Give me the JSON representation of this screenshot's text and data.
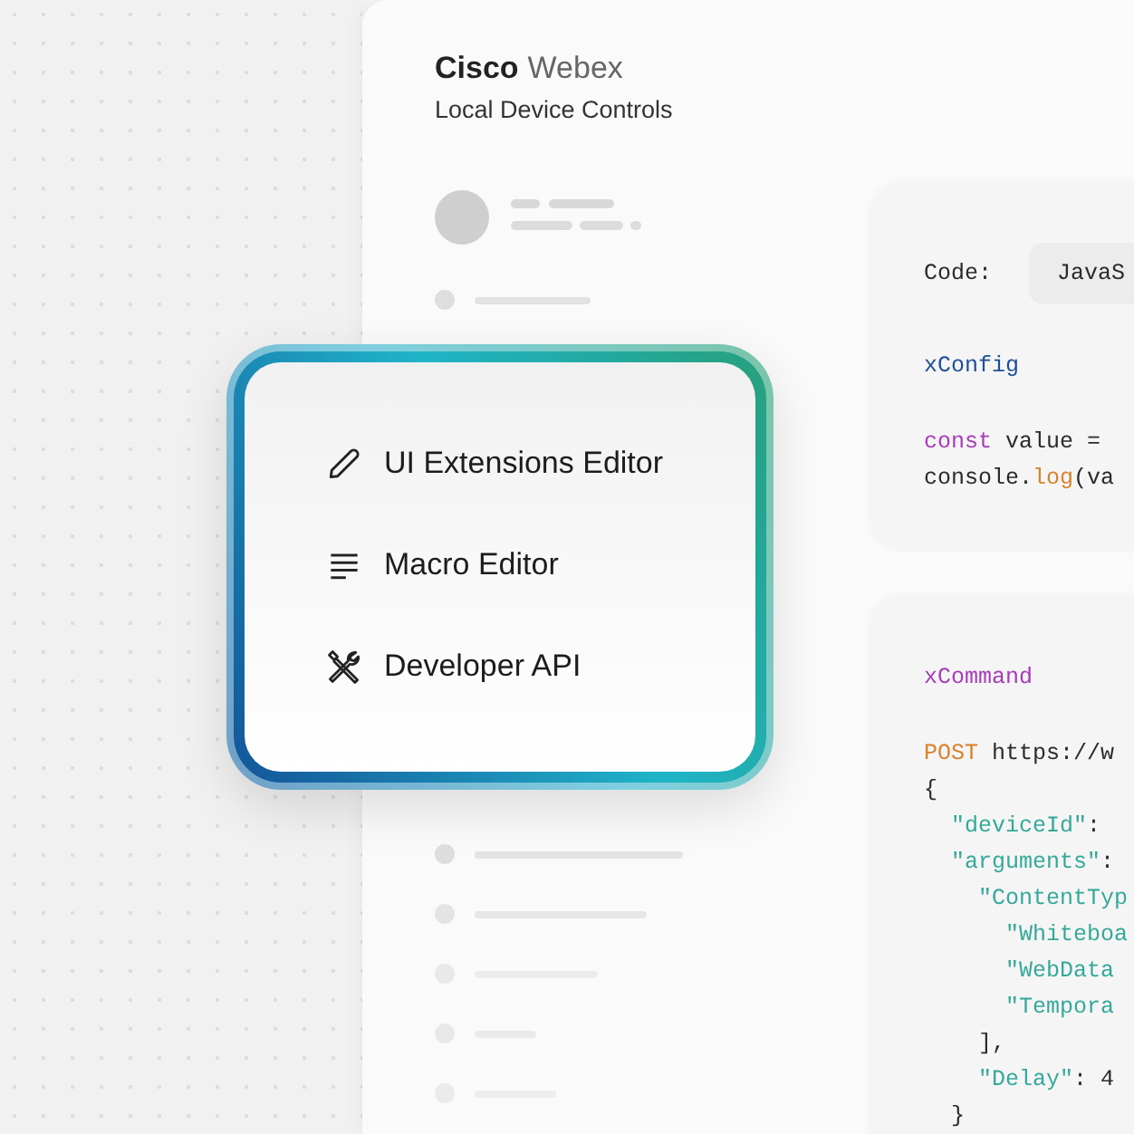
{
  "header": {
    "brand": "Cisco",
    "product": "Webex",
    "subtitle": "Local Device Controls"
  },
  "menu": {
    "items": [
      {
        "label": "UI Extensions Editor"
      },
      {
        "label": "Macro Editor"
      },
      {
        "label": "Developer API"
      }
    ]
  },
  "code_panels": [
    {
      "language_label": "Code:",
      "language": "JavaS",
      "blocks": [
        [
          [
            {
              "text": "xConfig",
              "kind": "type"
            }
          ]
        ],
        [
          [
            {
              "text": "const",
              "kind": "keyword"
            },
            {
              "text": " value =",
              "kind": "plain"
            }
          ],
          [
            {
              "text": "console.",
              "kind": "plain"
            },
            {
              "text": "log",
              "kind": "func"
            },
            {
              "text": "(va",
              "kind": "plain"
            }
          ]
        ]
      ]
    },
    {
      "blocks": [
        [
          [
            {
              "text": "xCommand",
              "kind": "keyword"
            }
          ]
        ],
        [
          [
            {
              "text": "POST",
              "kind": "func"
            },
            {
              "text": " https://w",
              "kind": "plain"
            }
          ],
          [
            {
              "text": "{",
              "kind": "plain"
            }
          ],
          [
            {
              "text": "  \"deviceId\"",
              "kind": "string"
            },
            {
              "text": ":",
              "kind": "plain"
            }
          ],
          [
            {
              "text": "  \"arguments\"",
              "kind": "string"
            },
            {
              "text": ":",
              "kind": "plain"
            }
          ],
          [
            {
              "text": "    \"ContentTyp",
              "kind": "string"
            }
          ],
          [
            {
              "text": "      \"Whiteboa",
              "kind": "string"
            }
          ],
          [
            {
              "text": "      \"WebData",
              "kind": "string"
            }
          ],
          [
            {
              "text": "      \"Tempora",
              "kind": "string"
            }
          ],
          [
            {
              "text": "    ],",
              "kind": "plain"
            }
          ],
          [
            {
              "text": "    \"Delay\"",
              "kind": "string"
            },
            {
              "text": ": 4",
              "kind": "plain"
            }
          ],
          [
            {
              "text": "  }",
              "kind": "plain"
            }
          ]
        ]
      ]
    }
  ]
}
